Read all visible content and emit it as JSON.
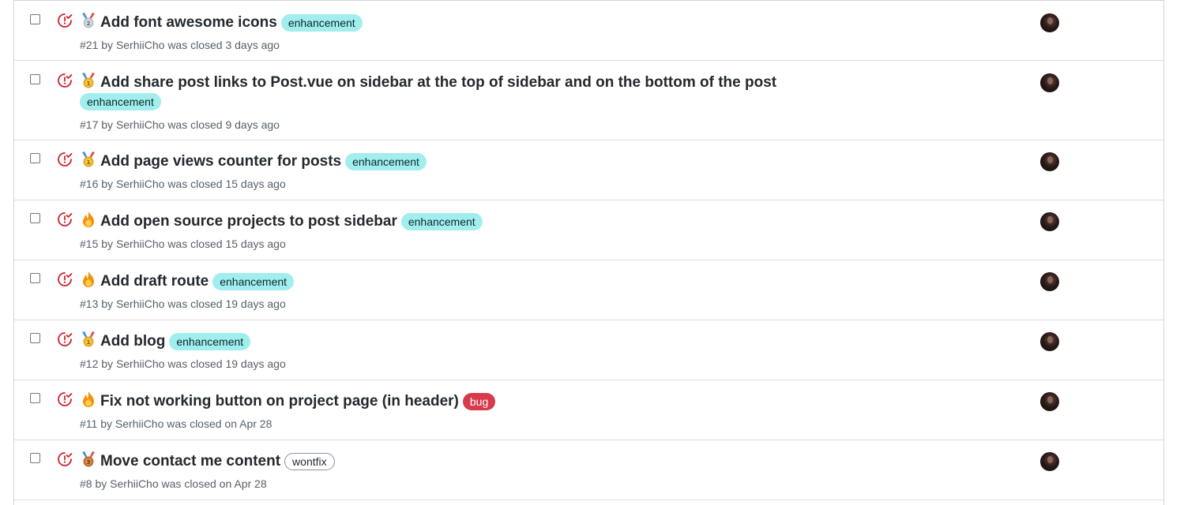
{
  "issues": [
    {
      "emoji": "medal-2",
      "title": "Add font awesome icons",
      "label": "enhancement",
      "label_type": "enh",
      "number": "#21",
      "author": "SerhiiCho",
      "closed": "was closed 3 days ago"
    },
    {
      "emoji": "medal-1",
      "title": "Add share post links to Post.vue on sidebar at the top of sidebar and on the bottom of the post",
      "label": "enhancement",
      "label_type": "enh",
      "number": "#17",
      "author": "SerhiiCho",
      "closed": "was closed 9 days ago"
    },
    {
      "emoji": "medal-1",
      "title": "Add page views counter for posts",
      "label": "enhancement",
      "label_type": "enh",
      "number": "#16",
      "author": "SerhiiCho",
      "closed": "was closed 15 days ago"
    },
    {
      "emoji": "fire",
      "title": "Add open source projects to post sidebar",
      "label": "enhancement",
      "label_type": "enh",
      "number": "#15",
      "author": "SerhiiCho",
      "closed": "was closed 15 days ago"
    },
    {
      "emoji": "fire",
      "title": "Add draft route",
      "label": "enhancement",
      "label_type": "enh",
      "number": "#13",
      "author": "SerhiiCho",
      "closed": "was closed 19 days ago"
    },
    {
      "emoji": "medal-1",
      "title": "Add blog",
      "label": "enhancement",
      "label_type": "enh",
      "number": "#12",
      "author": "SerhiiCho",
      "closed": "was closed 19 days ago"
    },
    {
      "emoji": "fire",
      "title": "Fix not working button on project page (in header)",
      "label": "bug",
      "label_type": "bug",
      "number": "#11",
      "author": "SerhiiCho",
      "closed": "was closed on Apr 28"
    },
    {
      "emoji": "medal-3",
      "title": "Move contact me content",
      "label": "wontfix",
      "label_type": "wont",
      "number": "#8",
      "author": "SerhiiCho",
      "closed": "was closed on Apr 28"
    }
  ],
  "by_word": "by",
  "colors": {
    "closed_icon": "#cf222e",
    "enhancement": "#a2eeef",
    "bug": "#d73a4a",
    "wontfix_border": "#8c959f"
  }
}
